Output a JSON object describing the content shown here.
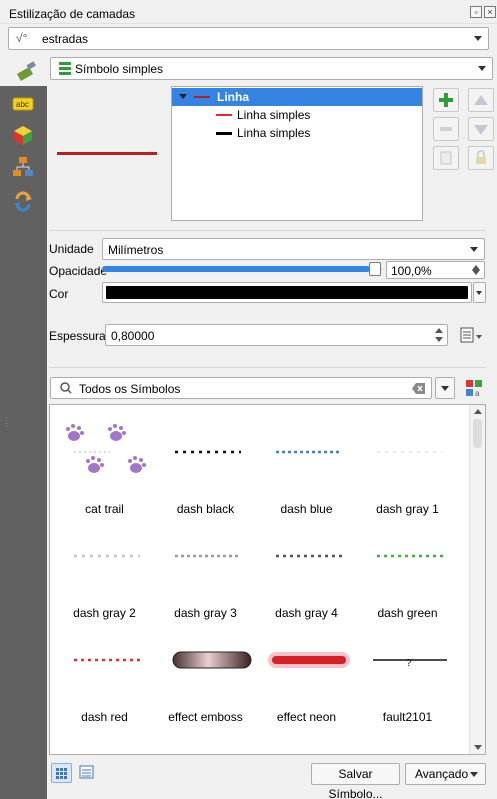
{
  "window": {
    "title": "Estilização de camadas"
  },
  "layer_select": {
    "value": "estradas"
  },
  "renderer_select": {
    "value": "Símbolo simples"
  },
  "symbol_tree": {
    "root": "Linha",
    "children": [
      "Linha simples",
      "Linha simples"
    ],
    "child_colors": [
      "#e8282e",
      "#000000"
    ]
  },
  "properties": {
    "unit_label": "Unidade",
    "unit_value": "Milímetros",
    "opacity_label": "Opacidade",
    "opacity_value": "100,0%",
    "opacity_level": 1.0,
    "color_label": "Cor",
    "color_value": "#000000",
    "width_label": "Espessura",
    "width_value": "0,80000"
  },
  "search": {
    "placeholder": "Todos os Símbolos"
  },
  "symbols": [
    "cat trail",
    "dash  black",
    "dash blue",
    "dash gray 1",
    "dash gray 2",
    "dash gray 3",
    "dash gray 4",
    "dash green",
    "dash red",
    "effect emboss",
    "effect neon",
    "fault2101"
  ],
  "footer": {
    "save_label": "Salvar Símbolo...",
    "advanced_label": "Avançado"
  },
  "colors": {
    "selection": "#3584e4",
    "sidebar": "#616161",
    "preview_line": "#b22222"
  }
}
